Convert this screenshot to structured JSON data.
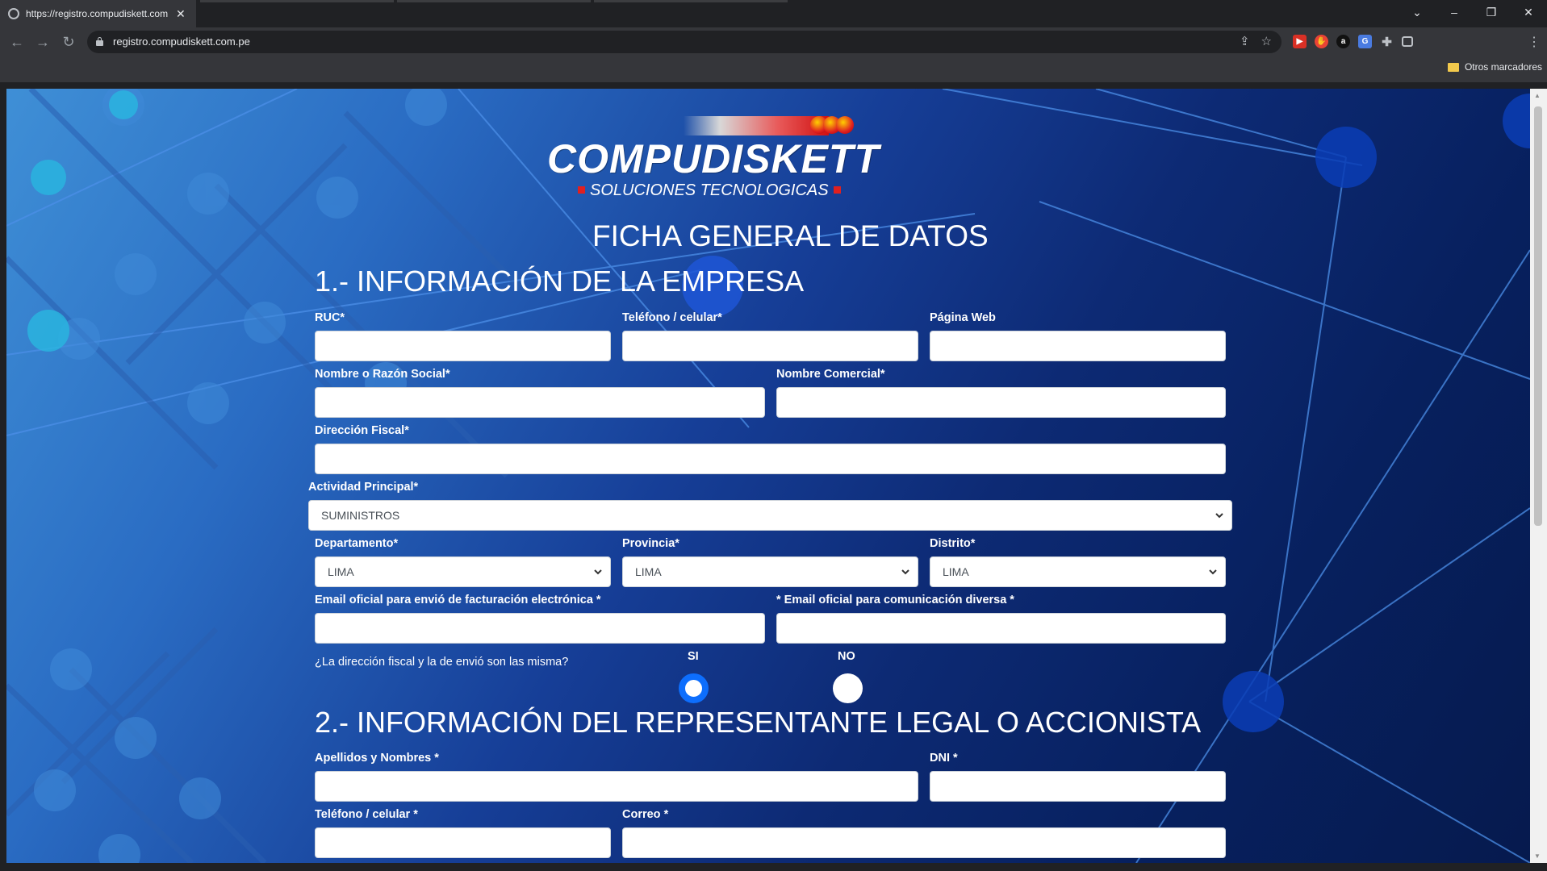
{
  "browser": {
    "tab_title": "https://registro.compudiskett.com",
    "url": "registro.compudiskett.com.pe",
    "bookmarks_other": "Otros marcadores"
  },
  "icons": {
    "back": "arrow-left-icon",
    "forward": "arrow-right-icon",
    "reload": "reload-icon",
    "share": "share-icon",
    "star": "star-icon",
    "extensions": "puzzle-icon",
    "side_panel": "side-panel-icon",
    "menu": "more-vert-icon"
  },
  "logo": {
    "name": "COMPUDISKETT",
    "tagline": "SOLUCIONES TECNOLOGICAS"
  },
  "form": {
    "title": "FICHA GENERAL DE DATOS",
    "section1": {
      "heading": "1.- INFORMACIÓN DE LA EMPRESA",
      "ruc_label": "RUC*",
      "telefono_label": "Teléfono / celular*",
      "pagina_web_label": "Página Web",
      "razon_social_label": "Nombre o Razón Social*",
      "nombre_comercial_label": "Nombre Comercial*",
      "direccion_fiscal_label": "Dirección Fiscal*",
      "actividad_label": "Actividad Principal*",
      "actividad_value": "SUMINISTROS",
      "departamento_label": "Departamento*",
      "departamento_value": "LIMA",
      "provincia_label": "Provincia*",
      "provincia_value": "LIMA",
      "distrito_label": "Distrito*",
      "distrito_value": "LIMA",
      "email_facturacion_label": "Email oficial para envió de facturación electrónica *",
      "email_comunicacion_label": "* Email oficial para comunicación diversa *",
      "same_address_question": "¿La dirección fiscal y la de envió son las misma?",
      "option_si": "SI",
      "option_no": "NO",
      "selected_option": "SI"
    },
    "section2": {
      "heading": "2.- INFORMACIÓN DEL REPRESENTANTE LEGAL O ACCIONISTA",
      "apellidos_label": "Apellidos y Nombres *",
      "dni_label": "DNI *",
      "telefono_label": "Teléfono / celular *",
      "correo_label": "Correo *"
    }
  },
  "colors": {
    "radio_selected": "#0d6efd",
    "logo_red": "#e02020",
    "background_dark": "#061a4e",
    "background_light": "#3f8fd6"
  }
}
